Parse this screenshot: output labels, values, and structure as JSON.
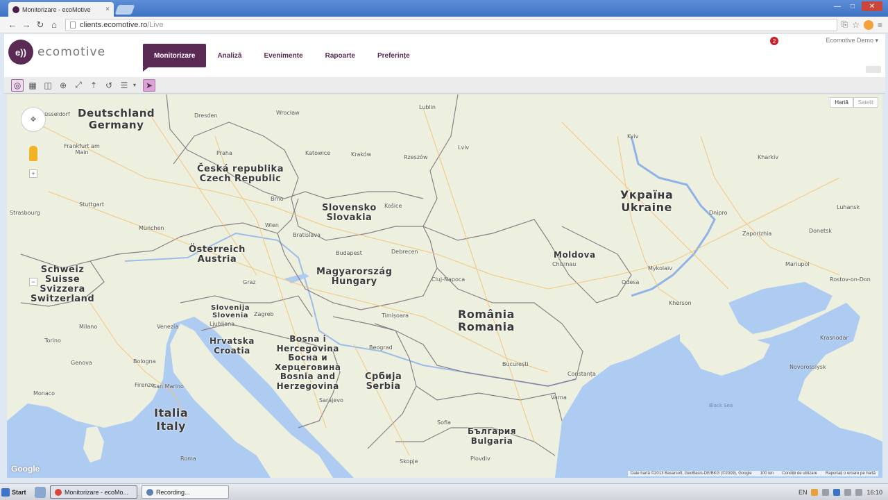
{
  "browser": {
    "tab_title": "Monitorizare - ecoMotive",
    "tab_close": "×",
    "url_host": "clients.ecomotive.ro",
    "url_path": "/Live"
  },
  "header": {
    "logo_text": "ecomotive",
    "nav": [
      "Monitorizare",
      "Analiză",
      "Evenimente",
      "Rapoarte",
      "Preferințe"
    ],
    "notification_count": "2",
    "user": "Ecomotive Demo"
  },
  "map": {
    "type_buttons": [
      "Hartă",
      "Satelit"
    ],
    "countries": [
      [
        "Deutschland",
        "Germany"
      ],
      [
        "Česká republika",
        "Czech Republic"
      ],
      [
        "Slovensko",
        "Slovakia"
      ],
      [
        "Österreich",
        "Austria"
      ],
      [
        "Schweiz",
        "Suisse",
        "Svizzera",
        "Switzerland"
      ],
      [
        "Magyarország",
        "Hungary"
      ],
      [
        "Slovenija",
        "Slovenia"
      ],
      [
        "Hrvatska",
        "Croatia"
      ],
      [
        "Bosna i",
        "Hercegovina",
        "Босна и",
        "Херцеговина",
        "Bosnia and",
        "Herzegovina"
      ],
      [
        "Србија",
        "Serbia"
      ],
      [
        "România",
        "Romania"
      ],
      [
        "Україна",
        "Ukraine"
      ],
      [
        "Moldova"
      ],
      [
        "Italia",
        "Italy"
      ],
      [
        "България",
        "Bulgaria"
      ]
    ],
    "cities": [
      "Düsseldorf",
      "Frankfurt am Main",
      "Stuttgart",
      "Strasbourg",
      "München",
      "Dresden",
      "Praha",
      "Wrocław",
      "Katowice",
      "Kraków",
      "Lublin",
      "Rzeszów",
      "Lviv",
      "Brno",
      "Wien",
      "Bratislava",
      "Košice",
      "Budapest",
      "Debrecen",
      "Cluj-Napoca",
      "Timișoara",
      "București",
      "Constanța",
      "Beograd",
      "Sarajevo",
      "Zagreb",
      "Ljubljana",
      "Graz",
      "Venezia",
      "Milano",
      "Torino",
      "Genova",
      "Bologna",
      "Firenze",
      "Monaco",
      "San Marino",
      "Roma",
      "Sofia",
      "Varna",
      "Plovdiv",
      "Skopje",
      "Kyiv",
      "Odesa",
      "Chisinau",
      "Dnipro",
      "Zaporizhia",
      "Kharkiv",
      "Donetsk",
      "Mykolaiv",
      "Kherson",
      "Krasnodar",
      "Novorossiysk",
      "Rostov-on-Don",
      "Luhansk",
      "Mariupol"
    ],
    "sea_label": "Black Sea",
    "attribution": "Date hartă ©2013 Basarsoft, GeoBasis-DE/BKG (©2009), Google",
    "scale": "100 km",
    "terms": "Condiții de utilizare",
    "report": "Raportați o eroare pe hartă",
    "google": "Google"
  },
  "taskbar": {
    "start": "Start",
    "items": [
      "Monitorizare - ecoMo...",
      "Recording..."
    ],
    "lang": "EN",
    "clock": "16:10"
  },
  "colors": {
    "brand": "#5a2a55",
    "land": "#eef0df",
    "water": "#aecbf1",
    "border": "#8a7f88"
  }
}
